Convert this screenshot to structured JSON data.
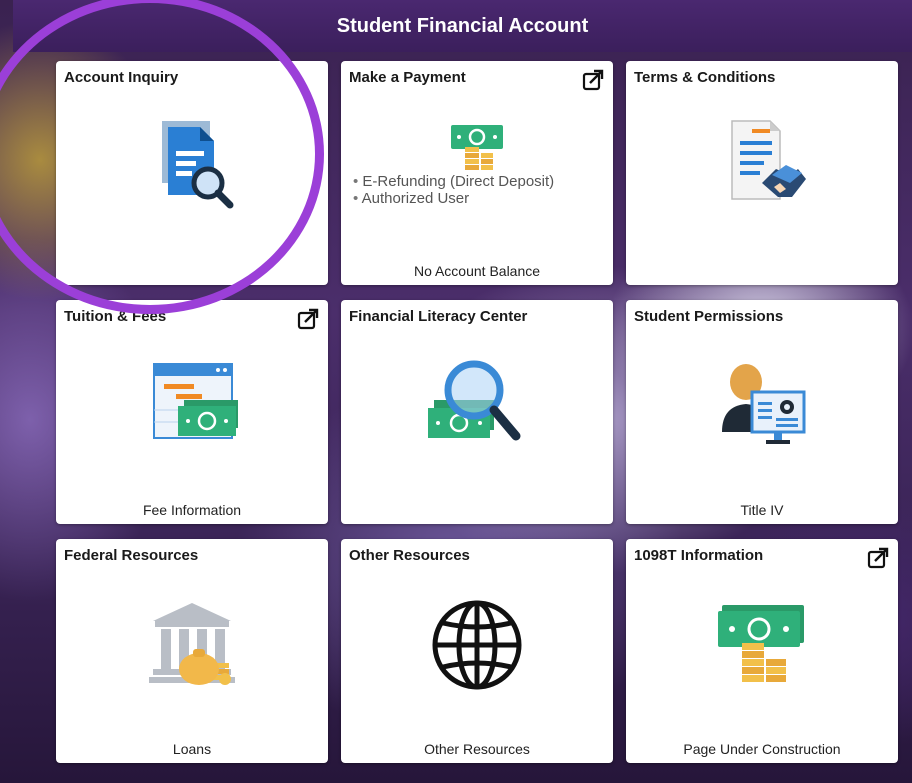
{
  "header": {
    "title": "Student Financial Account"
  },
  "tiles": [
    {
      "title": "Account Inquiry",
      "icon": "document-search-icon",
      "footer": ""
    },
    {
      "title": "Make a Payment",
      "icon": "money-coins-icon",
      "external": true,
      "list": [
        "E-Refunding (Direct Deposit)",
        "Authorized User"
      ],
      "footer": "No Account Balance"
    },
    {
      "title": "Terms & Conditions",
      "icon": "document-handshake-icon",
      "footer": ""
    },
    {
      "title": "Tuition & Fees",
      "icon": "calendar-money-icon",
      "external": true,
      "footer": "Fee Information"
    },
    {
      "title": "Financial Literacy Center",
      "icon": "magnifier-money-icon",
      "footer": ""
    },
    {
      "title": "Student Permissions",
      "icon": "person-monitor-icon",
      "footer": "Title IV"
    },
    {
      "title": "Federal Resources",
      "icon": "bank-money-bag-icon",
      "footer": "Loans"
    },
    {
      "title": "Other Resources",
      "icon": "globe-icon",
      "footer": "Other Resources"
    },
    {
      "title": "1098T Information",
      "icon": "money-coins-icon",
      "external": true,
      "footer": "Page Under Construction"
    }
  ],
  "colors": {
    "header": "#3b1f5c",
    "highlight": "#9b3fd8",
    "accent_blue": "#2a7fd4",
    "money_green": "#2fb07a",
    "coin_gold": "#f2c04a"
  }
}
